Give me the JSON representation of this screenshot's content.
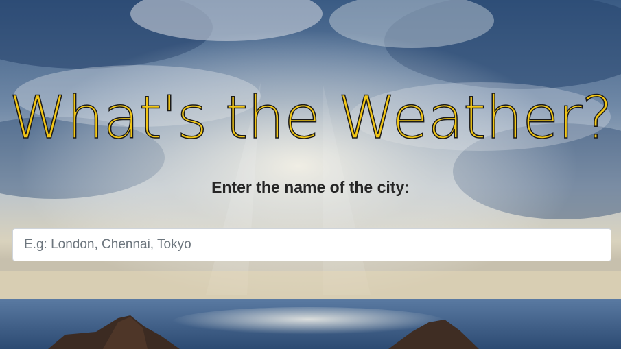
{
  "page": {
    "title": "What's the Weather?",
    "prompt_label": "Enter the name of the city:"
  },
  "search": {
    "placeholder": "E.g: London, Chennai, Tokyo",
    "value": ""
  },
  "colors": {
    "title_fill": "#f2c615",
    "title_outline": "#1a1a1a",
    "label_text": "#262626",
    "input_bg": "#ffffff",
    "sky_dark": "#2e4c74",
    "sea": "#3d5f8a"
  },
  "background": {
    "icon": "sky-sea-landscape-photo"
  }
}
